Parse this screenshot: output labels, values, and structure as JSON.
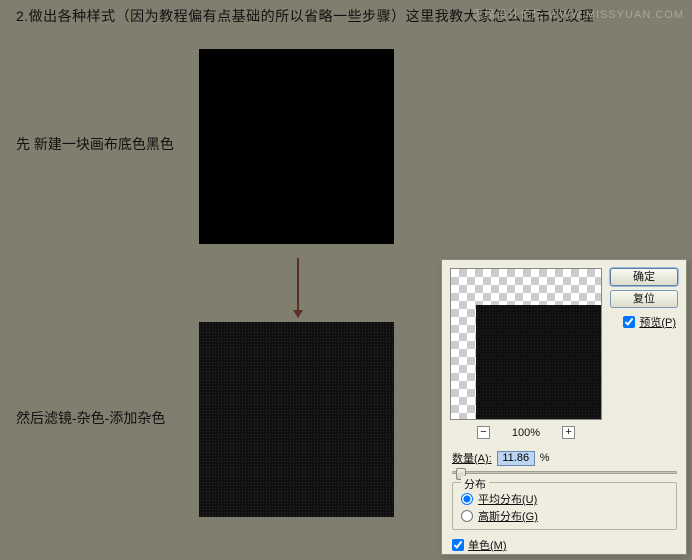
{
  "topText": "2.做出各种样式（因为教程偏有点基础的所以省略一些步骤）这里我教大家怎么画布的纹理",
  "watermark": "思缘设计论坛 WWW.MISSYUAN.COM",
  "caption1": "先 新建一块画布底色黑色",
  "caption2": "然后滤镜-杂色-添加杂色",
  "dialog": {
    "okLabel": "确定",
    "cancelLabel": "复位",
    "previewLabel": "预览(P)",
    "zoomValue": "100%",
    "amountLabel": "数量(A):",
    "amountValue": "11.86",
    "amountUnit": "%",
    "distributionLegend": "分布",
    "uniformLabel": "平均分布(U)",
    "gaussianLabel": "高斯分布(G)",
    "monoLabel": "单色(M)"
  }
}
